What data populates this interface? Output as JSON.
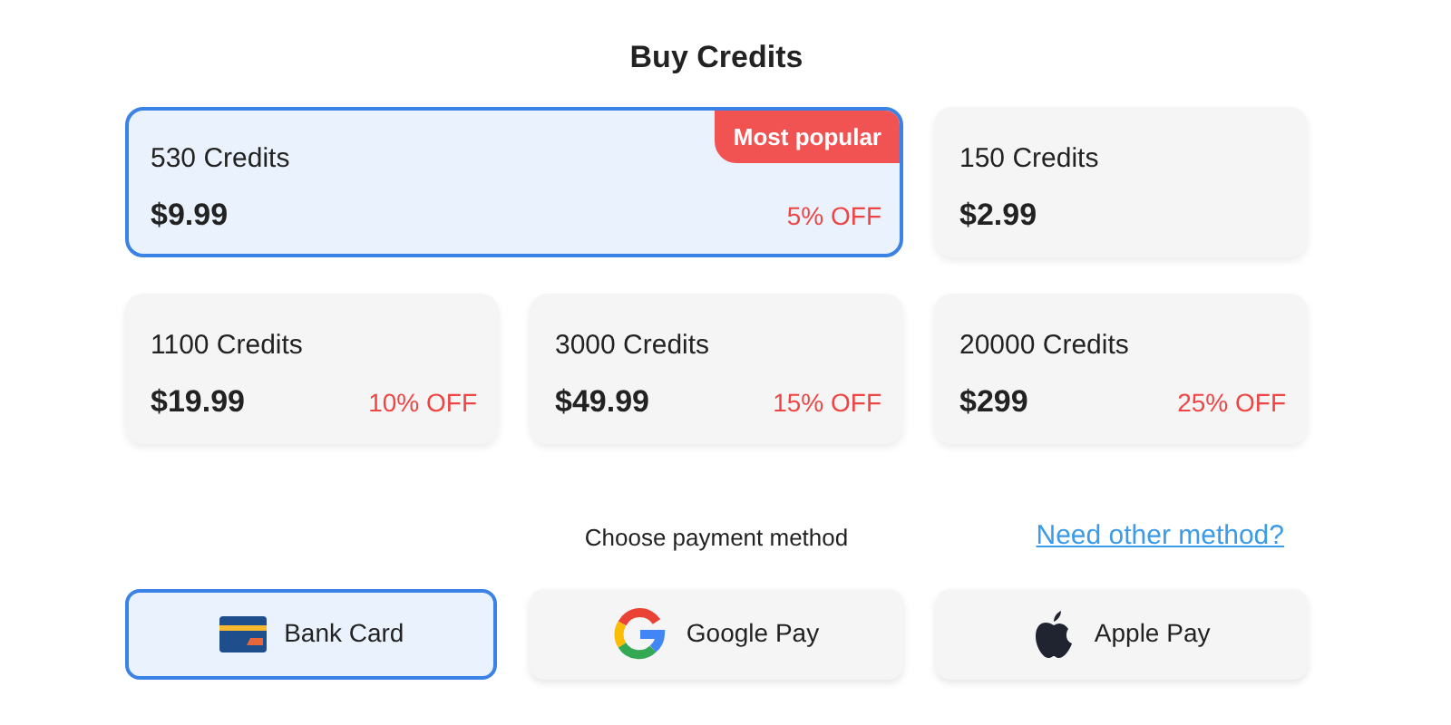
{
  "title": "Buy Credits",
  "packages": [
    {
      "credits": "530 Credits",
      "price": "$9.99",
      "discount": "5% OFF",
      "badge": "Most popular",
      "selected": true
    },
    {
      "credits": "150 Credits",
      "price": "$2.99",
      "selected": false
    },
    {
      "credits": "1100 Credits",
      "price": "$19.99",
      "discount": "10% OFF",
      "selected": false
    },
    {
      "credits": "3000 Credits",
      "price": "$49.99",
      "discount": "15% OFF",
      "selected": false
    },
    {
      "credits": "20000 Credits",
      "price": "$299",
      "discount": "25% OFF",
      "selected": false
    }
  ],
  "payment": {
    "label": "Choose payment method",
    "link": "Need other method?",
    "methods": [
      {
        "kind": "card",
        "label": "Bank Card",
        "selected": true
      },
      {
        "kind": "google",
        "label": "Google Pay",
        "selected": false
      },
      {
        "kind": "apple",
        "label": "Apple Pay",
        "selected": false
      }
    ]
  }
}
